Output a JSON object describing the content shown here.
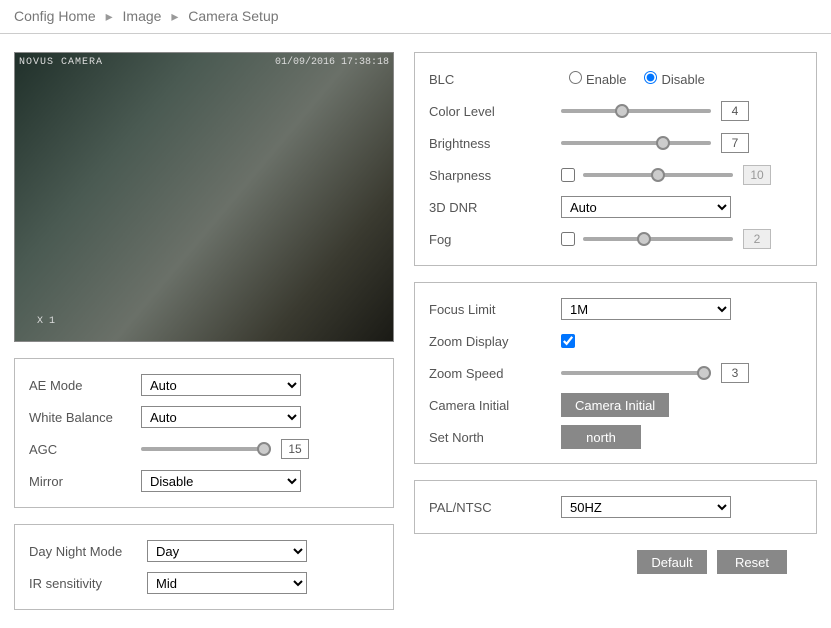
{
  "breadcrumb": {
    "config_home": "Config Home",
    "image": "Image",
    "camera_setup": "Camera Setup"
  },
  "video": {
    "overlay_tl": "NOVUS  CAMERA",
    "overlay_tr": "01/09/2016 17:38:18",
    "overlay_bl": "X 1"
  },
  "left1": {
    "ae_mode_lbl": "AE Mode",
    "ae_mode_val": "Auto",
    "wb_lbl": "White Balance",
    "wb_val": "Auto",
    "agc_lbl": "AGC",
    "agc_val": "15",
    "mirror_lbl": "Mirror",
    "mirror_val": "Disable"
  },
  "left2": {
    "dn_lbl": "Day Night Mode",
    "dn_val": "Day",
    "ir_lbl": "IR sensitivity",
    "ir_val": "Mid"
  },
  "right1": {
    "blc_lbl": "BLC",
    "blc_enable": "Enable",
    "blc_disable": "Disable",
    "blc_sel": "disable",
    "color_lbl": "Color Level",
    "color_val": "4",
    "bright_lbl": "Brightness",
    "bright_val": "7",
    "sharp_lbl": "Sharpness",
    "sharp_val": "10",
    "dnr_lbl": "3D DNR",
    "dnr_val": "Auto",
    "fog_lbl": "Fog",
    "fog_val": "2"
  },
  "right2": {
    "focus_lbl": "Focus Limit",
    "focus_val": "1M",
    "zdisp_lbl": "Zoom Display",
    "zspeed_lbl": "Zoom Speed",
    "zspeed_val": "3",
    "caminit_lbl": "Camera Initial",
    "caminit_btn": "Camera Initial",
    "north_lbl": "Set North",
    "north_btn": "north"
  },
  "right3": {
    "pal_lbl": "PAL/NTSC",
    "pal_val": "50HZ"
  },
  "footer": {
    "default": "Default",
    "reset": "Reset"
  }
}
